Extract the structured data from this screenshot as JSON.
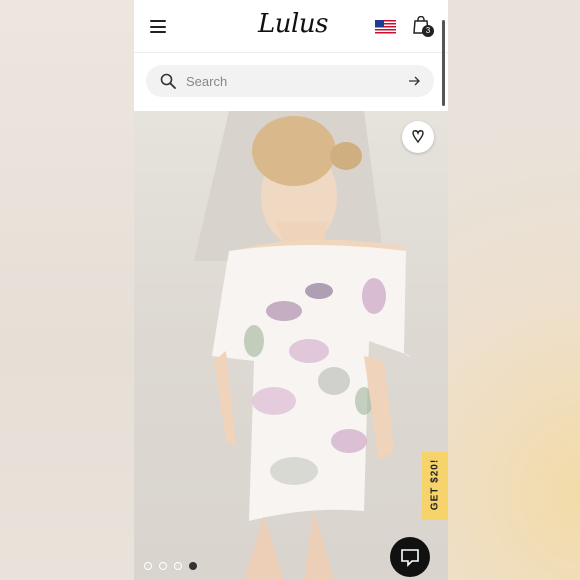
{
  "app": {
    "logo_text": "Lulus"
  },
  "header": {
    "menu_icon": "hamburger-menu-icon",
    "flag_icon": "us-flag-icon",
    "bag_icon": "shopping-bag-icon",
    "bag_count": "3"
  },
  "search": {
    "placeholder": "Search",
    "value": ""
  },
  "promo": {
    "label": "GET $20!",
    "color": "#f6d36b"
  },
  "carousel": {
    "count": 4,
    "active_index": 3
  },
  "colors": {
    "accent": "#111111",
    "promo": "#f6d36b"
  }
}
